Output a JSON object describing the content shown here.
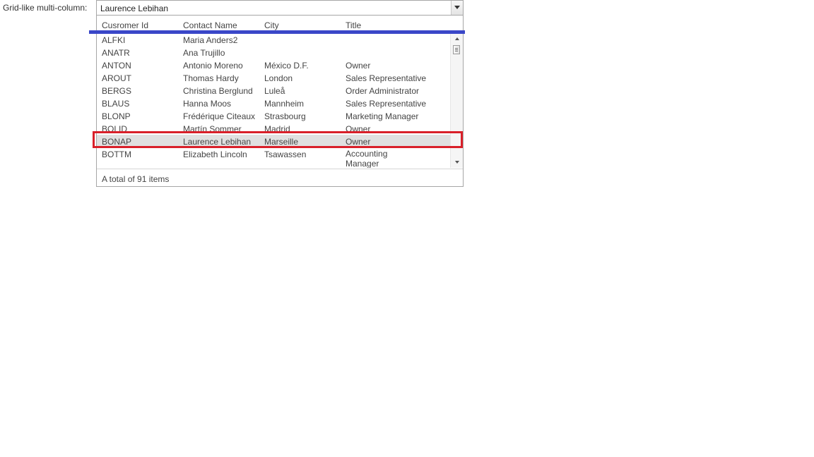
{
  "label": "Grid-like multi-column:",
  "combo": {
    "value": "Laurence Lebihan"
  },
  "columns": [
    "Cusromer Id",
    "Contact Name",
    "City",
    "Title"
  ],
  "rows": [
    {
      "id": "ALFKI",
      "name": "Maria Anders2",
      "city": "",
      "title": ""
    },
    {
      "id": "ANATR",
      "name": "Ana Trujillo",
      "city": "",
      "title": ""
    },
    {
      "id": "ANTON",
      "name": "Antonio Moreno",
      "city": "México D.F.",
      "title": "Owner"
    },
    {
      "id": "AROUT",
      "name": "Thomas Hardy",
      "city": "London",
      "title": "Sales Representative"
    },
    {
      "id": "BERGS",
      "name": "Christina Berglund",
      "city": "Luleå",
      "title": "Order Administrator"
    },
    {
      "id": "BLAUS",
      "name": "Hanna Moos",
      "city": "Mannheim",
      "title": "Sales Representative"
    },
    {
      "id": "BLONP",
      "name": "Frédérique Citeaux",
      "city": "Strasbourg",
      "title": "Marketing Manager"
    },
    {
      "id": "BOLID",
      "name": "Martín Sommer",
      "city": "Madrid",
      "title": "Owner"
    },
    {
      "id": "BONAP",
      "name": "Laurence Lebihan",
      "city": "Marseille",
      "title": "Owner"
    },
    {
      "id": "BOTTM",
      "name": "Elizabeth Lincoln",
      "city": "Tsawassen",
      "title": "Accounting Manager"
    }
  ],
  "selected_index": 8,
  "footer": "A total of 91 items",
  "colors": {
    "annotation_blue": "#3a47c8",
    "annotation_red": "#d9202a",
    "selection": "#e0e0e0"
  }
}
